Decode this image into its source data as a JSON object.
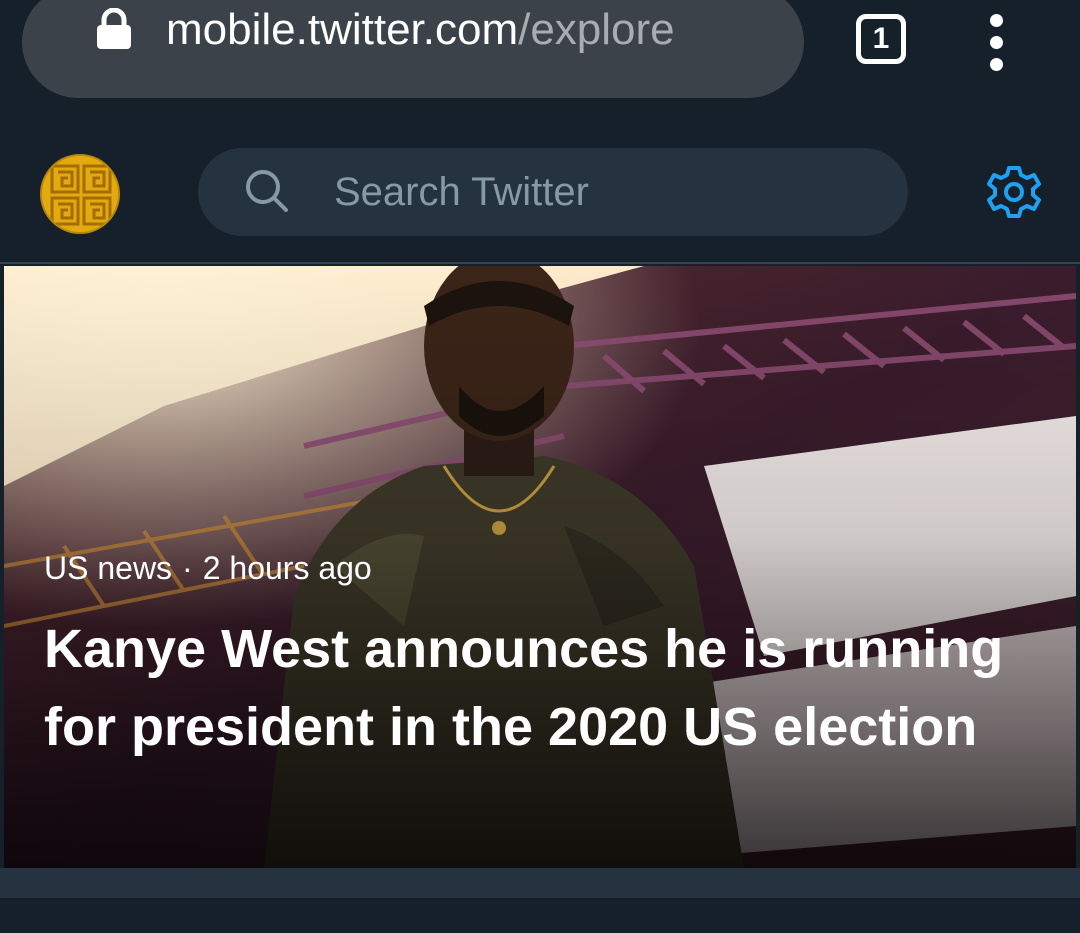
{
  "browser": {
    "url_host": "mobile.twitter.com",
    "url_path": "/explore",
    "tab_count": "1",
    "icons": [
      "lock-icon",
      "tabs-icon",
      "more-vert-icon"
    ]
  },
  "header": {
    "search_placeholder": "Search Twitter",
    "icons": [
      "avatar",
      "search-icon",
      "gear-icon"
    ],
    "accent_color": "#1da1f2"
  },
  "hero": {
    "category": "US news",
    "separator": "·",
    "time": "2 hours ago",
    "title": "Kanye West announces he is running for president in the 2020 US election"
  },
  "colors": {
    "background": "#15202b",
    "url_pill": "#3b4249",
    "search_box": "#253341",
    "placeholder": "#8899a6"
  }
}
